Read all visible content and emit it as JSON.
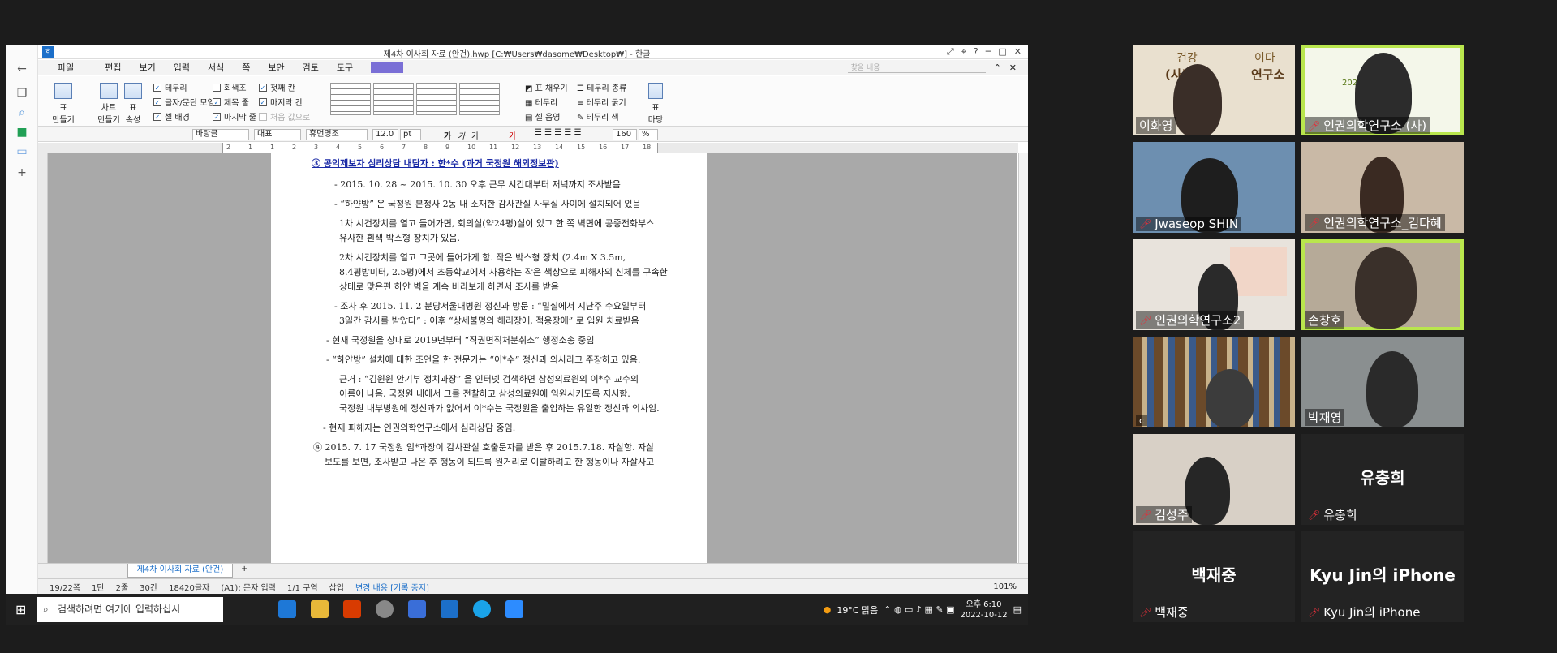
{
  "window": {
    "title": "제4차 이사회 자료 (안건).hwp [C:₩Users₩dasome₩Desktop₩] - 한글",
    "buttons": [
      "⤢",
      "⌖",
      "?",
      "─",
      "□",
      "✕"
    ]
  },
  "menu": {
    "items": [
      "파일",
      "편집",
      "보기",
      "입력",
      "서식",
      "쪽",
      "보안",
      "검토",
      "도구"
    ],
    "search_placeholder": "찾을 내용"
  },
  "ribbon": {
    "table_make": "표\n만들기",
    "chart_make": "차트\n만들기",
    "table_prop": "표\n속성",
    "checkboxes": [
      {
        "label": "테두리",
        "checked": true
      },
      {
        "label": "회색조",
        "checked": false
      },
      {
        "label": "첫째 칸",
        "checked": true
      },
      {
        "label": "글자/문단 모양",
        "checked": true
      },
      {
        "label": "제목 줄",
        "checked": true
      },
      {
        "label": "마지막 칸",
        "checked": true
      },
      {
        "label": "셀 배경",
        "checked": true
      },
      {
        "label": "마지막 줄",
        "checked": true
      },
      {
        "label": "처음 값으로",
        "checked": false
      }
    ],
    "right": [
      "표 채우기",
      "테두리 종류",
      "테두리",
      "테두리 굵기",
      "셀 음영",
      "테두리 색"
    ],
    "page_btn": "표\n마당"
  },
  "format": {
    "style": "바탕글",
    "font_group": "대표",
    "font": "휴먼명조",
    "size": "12.0",
    "unit": "pt",
    "zoom": "160",
    "zoom_unit": "%"
  },
  "ruler": [
    "2",
    "1",
    "1",
    "2",
    "3",
    "4",
    "5",
    "6",
    "7",
    "8",
    "9",
    "10",
    "11",
    "12",
    "13",
    "14",
    "15",
    "16",
    "17",
    "18"
  ],
  "document": {
    "lines": [
      "③ 공익제보자 심리상담 내담자 : 한*수 (과거 국정원 해외정보관)",
      "- 2015. 10. 28 ~ 2015. 10. 30 오후 근무 시간대부터 저녁까지 조사받음",
      "- “하얀방” 은 국정원 본청사 2동 내 소재한 감사관실 사무실 사이에 설치되어 있음",
      "1차 시건장치를 열고 들어가면, 회의실(약24평)실이 있고 한 쪽 벽면에 공중전화부스",
      "유사한 흰색 박스형 장치가 있음.",
      "2차 시건장치를 열고 그곳에 들어가게 함. 작은 박스형 장치 (2.4m X 3.5m,",
      "8.4평방미터, 2.5평)에서 초등학교에서 사용하는 작은 책상으로 피해자의 신체를 구속한",
      "상태로 맞은편 하얀 벽을 계속 바라보게 하면서 조사를 받음",
      "- 조사 후 2015. 11. 2 분당서울대병원 정신과 방문 : “밀실에서 지난주 수요일부터",
      "3일간 감사를 받았다” : 이후 “상세불명의 해리장애, 적응장애” 로 입원 치료받음",
      "- 현재 국정원을 상대로 2019년부터 “직권면직처분취소” 행정소송 중임",
      "- “하얀방” 설치에 대한 조언을 한 전문가는 “이*수” 정신과 의사라고 주장하고 있음.",
      "근거 : “김원원 안기부 정치과장” 을 인터넷 검색하면 삼성의료원의 이*수 교수의",
      "이름이 나옴. 국정원 내에서 그를 전찰하고 삼성의료원에 임원시키도록 지시함.",
      "국정원 내부병원에 정신과가 없어서 이*수는 국정원을 출입하는 유일한 정신과 의사임.",
      "- 현재 피해자는 인권의학연구소에서 심리상담 중임.",
      "④ 2015. 7. 17 국정원 임*과장이 감사관실 호출문자를 받은 후 2015.7.18. 자살함. 자살",
      "보도를 보면, 조사받고 나온 후 행동이 되도록 원거리로 이탈하려고 한 행동이나 자살사고"
    ]
  },
  "tabs": {
    "doc_tab": "제4차 이사회 자료 (안건)",
    "add": "+"
  },
  "status": {
    "items": [
      "19/22쪽",
      "1단",
      "2줄",
      "30칸",
      "18420글자",
      "(A1): 문자 입력",
      "1/1 구역",
      "삽입",
      "변경 내용 [기록 중지]"
    ],
    "zoom": "101%"
  },
  "taskbar": {
    "search": "검색하려면 여기에 입력하십시",
    "weather": "19°C 맑음",
    "time": "오후 6:10",
    "date": "2022-10-12"
  },
  "participants": [
    {
      "name": "이화영",
      "muted": false
    },
    {
      "name": "인권의학연구소 (사)",
      "muted": true
    },
    {
      "name": "Jwaseop SHIN",
      "muted": true
    },
    {
      "name": "인권의학연구소_김다혜",
      "muted": true
    },
    {
      "name": "인권의학연구소2",
      "muted": true
    },
    {
      "name": "손창호",
      "muted": false
    },
    {
      "name": "c",
      "muted": false
    },
    {
      "name": "박재영",
      "muted": false
    },
    {
      "name": "김성주",
      "muted": true
    },
    {
      "name": "유충희",
      "muted": true,
      "display": "유충희"
    },
    {
      "name": "백재중",
      "muted": true,
      "display": "백재중"
    },
    {
      "name": "Kyu Jin의 iPhone",
      "muted": true,
      "display": "Kyu Jin의 iPhone"
    }
  ],
  "tile_texts": {
    "tile1_banner": "건강",
    "tile1_banner2": "(사)",
    "tile1_banner3": "연구소",
    "tile1_banner4": "이다",
    "tile2_banner": "2022년"
  }
}
